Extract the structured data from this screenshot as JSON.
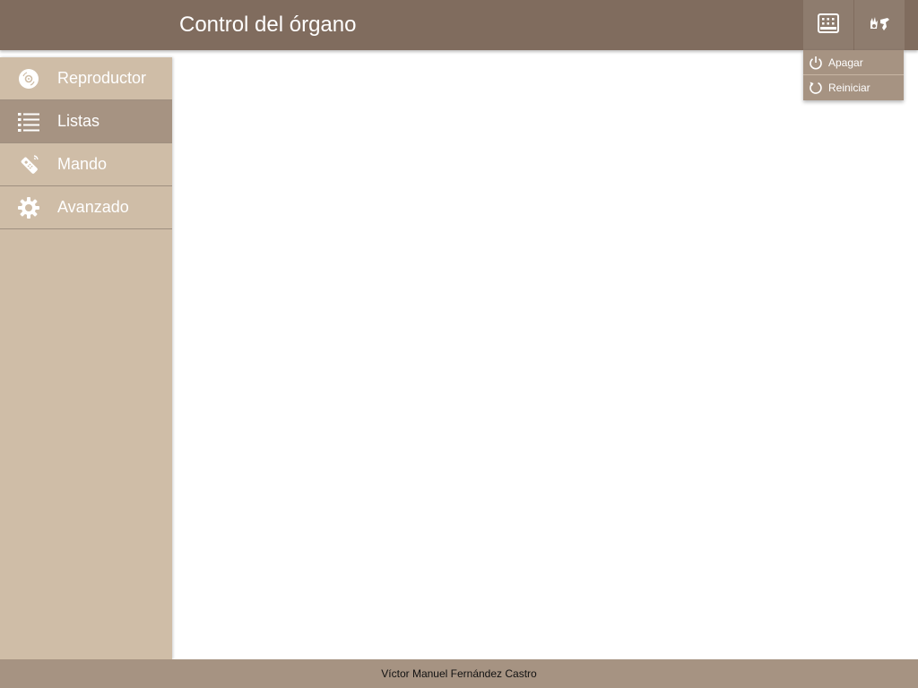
{
  "header": {
    "title": "Control del órgano",
    "buttons": [
      {
        "icon": "organ-icon"
      },
      {
        "icon": "sign-language-icon"
      }
    ]
  },
  "menu": {
    "items": [
      {
        "label": "Apagar",
        "icon": "power-icon"
      },
      {
        "label": "Reiniciar",
        "icon": "restart-icon"
      }
    ]
  },
  "sidebar": {
    "items": [
      {
        "label": "Reproductor",
        "icon": "disc-icon",
        "active": false
      },
      {
        "label": "Listas",
        "icon": "list-icon",
        "active": true
      },
      {
        "label": "Mando",
        "icon": "remote-icon",
        "active": false
      },
      {
        "label": "Avanzado",
        "icon": "gear-icon",
        "active": false
      }
    ]
  },
  "footer": {
    "text": "Víctor Manuel Fernández Castro"
  },
  "colors": {
    "header": "#806c5e",
    "sidebar": "#cfbda7",
    "active": "#a69382",
    "footer": "#a69382"
  }
}
